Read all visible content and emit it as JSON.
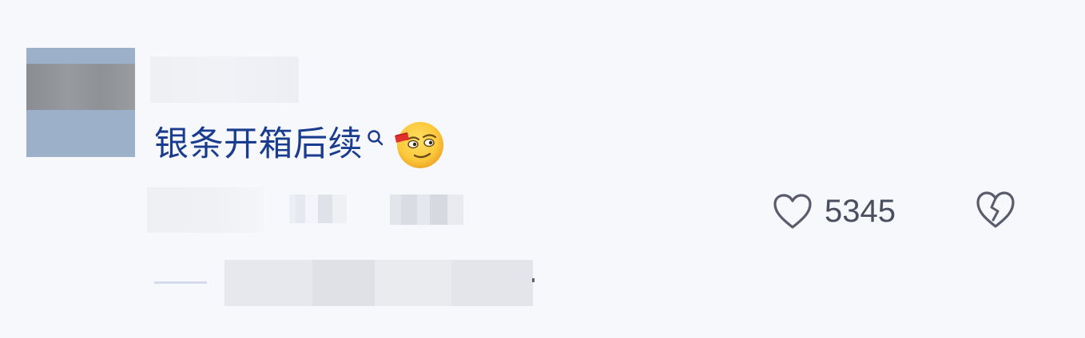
{
  "comment": {
    "avatar": {
      "icon": "user-avatar",
      "color": "#9cb0c9"
    },
    "username": "",
    "text": "银条开箱后续",
    "search_icon": "search-icon",
    "emoji": "wink-tongue-emoji",
    "likes": {
      "count": "5345",
      "icon": "heart-outline-icon"
    },
    "dislike": {
      "icon": "broken-heart-icon"
    },
    "reply": {
      "text": ""
    }
  },
  "colors": {
    "background": "#f7f8fc",
    "comment_text": "#1a3c8e",
    "icon_stroke": "#5a5c6e",
    "count_text": "#4a4e5e"
  }
}
